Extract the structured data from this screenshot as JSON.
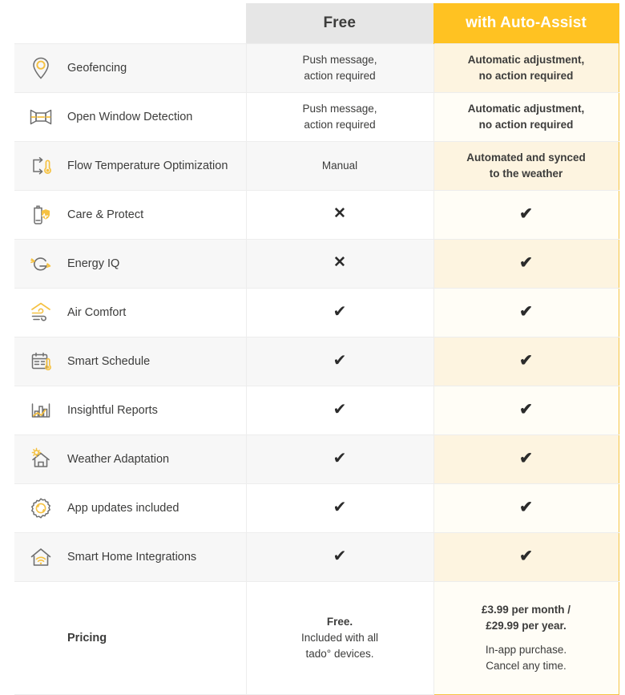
{
  "header": {
    "feature_col": "",
    "free_label": "Free",
    "auto_label": "with Auto-Assist"
  },
  "colors": {
    "accent": "#FFC222",
    "accent_border": "#F6C544",
    "header_gray": "#e6e6e6",
    "row_alt": "#f7f7f7",
    "auto_row_alt": "#fdf4e0",
    "auto_row": "#fffdf6",
    "text": "#3c3c3b"
  },
  "rows": [
    {
      "icon": "location-pin-icon",
      "feature": "Geofencing",
      "free": "Push message,\naction required",
      "auto": "Automatic adjustment,\nno action required",
      "free_type": "text",
      "auto_type": "text"
    },
    {
      "icon": "open-window-icon",
      "feature": "Open Window Detection",
      "free": "Push message,\naction required",
      "auto": "Automatic adjustment,\nno action required",
      "free_type": "text",
      "auto_type": "text"
    },
    {
      "icon": "flow-temperature-icon",
      "feature": "Flow Temperature Optimization",
      "free": "Manual",
      "auto": "Automated and synced\nto the weather",
      "free_type": "text",
      "auto_type": "text"
    },
    {
      "icon": "care-protect-shield-icon",
      "feature": "Care & Protect",
      "free": "✕",
      "auto": "✔",
      "free_type": "cross",
      "auto_type": "check"
    },
    {
      "icon": "energy-iq-icon",
      "feature": "Energy IQ",
      "free": "✕",
      "auto": "✔",
      "free_type": "cross",
      "auto_type": "check"
    },
    {
      "icon": "air-comfort-icon",
      "feature": "Air Comfort",
      "free": "✔",
      "auto": "✔",
      "free_type": "check",
      "auto_type": "check"
    },
    {
      "icon": "smart-schedule-calendar-icon",
      "feature": "Smart Schedule",
      "free": "✔",
      "auto": "✔",
      "free_type": "check",
      "auto_type": "check"
    },
    {
      "icon": "insightful-reports-chart-icon",
      "feature": "Insightful Reports",
      "free": "✔",
      "auto": "✔",
      "free_type": "check",
      "auto_type": "check"
    },
    {
      "icon": "weather-adaptation-house-sun-icon",
      "feature": "Weather Adaptation",
      "free": "✔",
      "auto": "✔",
      "free_type": "check",
      "auto_type": "check"
    },
    {
      "icon": "app-updates-gear-icon",
      "feature": "App updates included",
      "free": "✔",
      "auto": "✔",
      "free_type": "check",
      "auto_type": "check"
    },
    {
      "icon": "smart-home-wifi-icon",
      "feature": "Smart Home Integrations",
      "free": "✔",
      "auto": "✔",
      "free_type": "check",
      "auto_type": "check"
    }
  ],
  "pricing": {
    "label": "Pricing",
    "free": {
      "headline": "Free.",
      "line1": "Included with all",
      "line2": "tado° devices."
    },
    "auto": {
      "headline1": "£3.99 per month /",
      "headline2": "£29.99 per year.",
      "line1": "In-app purchase.",
      "line2": "Cancel any time."
    }
  }
}
